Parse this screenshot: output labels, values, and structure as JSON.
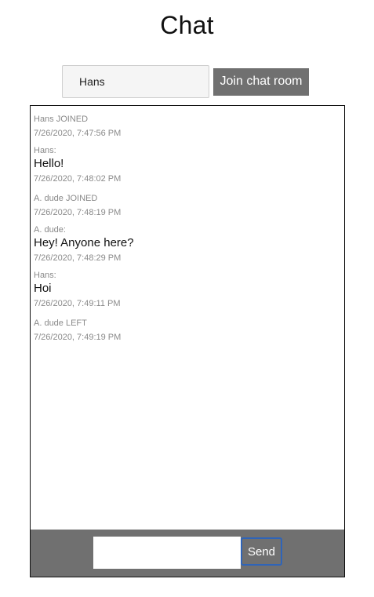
{
  "page": {
    "title": "Chat"
  },
  "join": {
    "name_value": "Hans",
    "button_label": "Join chat room"
  },
  "messages": [
    {
      "type": "event",
      "text": "Hans JOINED",
      "time": "7/26/2020, 7:47:56 PM"
    },
    {
      "type": "message",
      "sender": "Hans:",
      "text": "Hello!",
      "time": "7/26/2020, 7:48:02 PM"
    },
    {
      "type": "event",
      "text": "A. dude JOINED",
      "time": "7/26/2020, 7:48:19 PM"
    },
    {
      "type": "message",
      "sender": "A. dude:",
      "text": "Hey! Anyone here?",
      "time": "7/26/2020, 7:48:29 PM"
    },
    {
      "type": "message",
      "sender": "Hans:",
      "text": "Hoi",
      "time": "7/26/2020, 7:49:11 PM"
    },
    {
      "type": "event",
      "text": "A. dude LEFT",
      "time": "7/26/2020, 7:49:19 PM"
    }
  ],
  "composer": {
    "message_value": "",
    "send_label": "Send"
  },
  "colors": {
    "button_gray": "#707070",
    "send_border": "#2f64b8",
    "meta_text": "#8a8a8a"
  }
}
